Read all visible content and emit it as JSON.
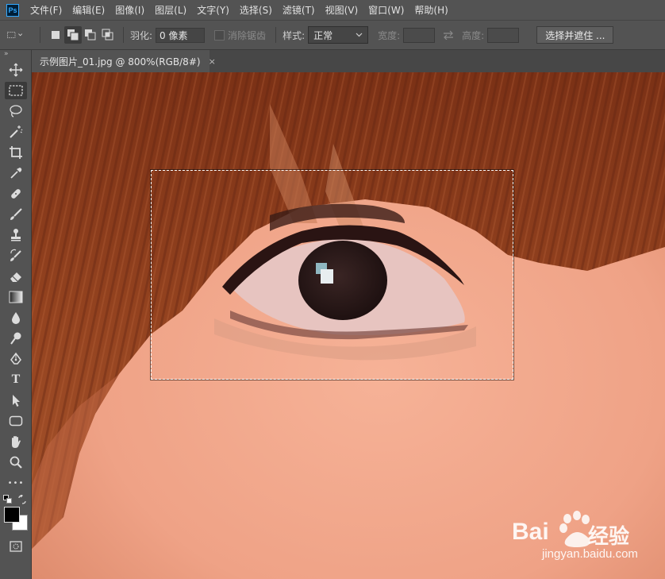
{
  "app": {
    "logo": "Ps"
  },
  "menu": [
    "文件(F)",
    "编辑(E)",
    "图像(I)",
    "图层(L)",
    "文字(Y)",
    "选择(S)",
    "滤镜(T)",
    "视图(V)",
    "窗口(W)",
    "帮助(H)"
  ],
  "options": {
    "feather_label": "羽化:",
    "feather_value": "0 像素",
    "antialias_label": "消除锯齿",
    "style_label": "样式:",
    "style_value": "正常",
    "width_label": "宽度:",
    "height_label": "高度:",
    "select_mask_button": "选择并遮住 ..."
  },
  "document": {
    "tab_title": "示例图片_01.jpg @ 800%(RGB/8#)",
    "close_glyph": "×"
  },
  "toolbar": {
    "collapse_glyph": "»",
    "more_glyph": "•••",
    "type_tool_glyph": "T",
    "foreground_color": "#000000",
    "background_color": "#ffffff"
  },
  "watermark": {
    "brand": "Bai",
    "brand_suffix": "经验",
    "url": "jingyan.baidu.com"
  }
}
